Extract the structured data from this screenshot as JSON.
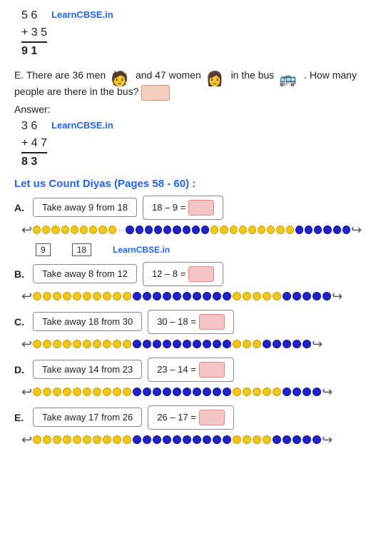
{
  "brand": "LearnCBSE",
  "brand_tld": ".in",
  "top_addition": {
    "line1": "5 6",
    "line2": "+ 3 5",
    "result": "9 1"
  },
  "question_e": {
    "text_before": "E. There are 36 men",
    "text_middle": "and 47 women",
    "text_after": "in the bus",
    "text_end": ". How many people are there in the bus?",
    "answer_label": "Answer:"
  },
  "answer_addition": {
    "line1": "3 6",
    "line2": "+ 4 7",
    "result": "8 3"
  },
  "section_title": "Let us Count Diyas (Pages 58 - 60) :",
  "exercises": [
    {
      "label": "A.",
      "take_away_text": "Take away 9 from 18",
      "equation": "18 – 9 =",
      "answer": "",
      "nl_boxes": [
        "9",
        "18"
      ],
      "show_brand": true
    },
    {
      "label": "B.",
      "take_away_text": "Take away 8 from 12",
      "equation": "12 – 8 =",
      "answer": "",
      "show_brand": false
    },
    {
      "label": "C.",
      "take_away_text": "Take away 18 from 30",
      "equation": "30 – 18 =",
      "answer": "",
      "show_brand": false
    },
    {
      "label": "D.",
      "take_away_text": "Take away 14 from 23",
      "equation": "23 – 14 =",
      "answer": "",
      "show_brand": false
    },
    {
      "label": "E.",
      "take_away_text": "Take away 17 from 26",
      "equation": "26 – 17 =",
      "answer": "",
      "show_brand": false
    }
  ]
}
